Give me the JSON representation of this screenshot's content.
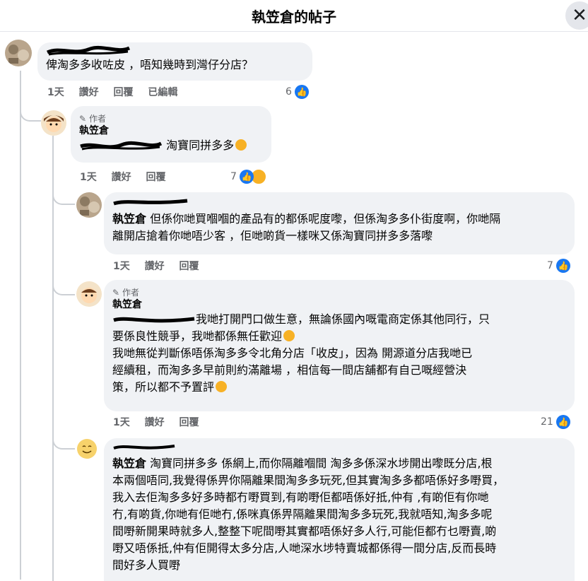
{
  "header": {
    "title": "執笠倉的帖子",
    "close_label": "✕"
  },
  "author_tag_label": "作者",
  "obj_char": "OBJ",
  "comments": [
    {
      "text": "俾淘多多收咗皮 ，唔知幾時到灣仔分店？",
      "time": "1天",
      "like": "讚好",
      "reply": "回覆",
      "edited": "已編輯",
      "reactions": "6"
    },
    {
      "name": "執笠倉",
      "text": "淘寶同拼多多",
      "time": "1天",
      "like": "讚好",
      "reply": "回覆",
      "reactions": "7"
    },
    {
      "mention": "執笠倉",
      "text_line1": "但係你哋買嗰嗰的產品有的都係呢度嚟，但係淘多多仆街度啊，你哋隔",
      "text_line2": "離開店搶着你哋唔少客 ，佢哋啲貨一樣咪又係淘寶同拼多多落嚟",
      "time": "1天",
      "like": "讚好",
      "reply": "回覆",
      "reactions": "7"
    },
    {
      "name": "執笠倉",
      "text_line1": "我哋打開門口做生意，無論係國內嘅電商定係其他同行，只",
      "text_line2": "要係良性競爭，我哋都係無任歡迎",
      "text_line3": "我哋無從判斷係唔係淘多多令北角分店「收皮」，因為 開源道分店我哋已",
      "text_line4": "經續租，而淘多多早前則約滿離場 ，相信每一間店舖都有自己嘅經營決",
      "text_line5": "策，所以都不予置評",
      "time": "1天",
      "like": "讚好",
      "reply": "回覆",
      "reactions": "21"
    },
    {
      "mention": "執笠倉",
      "text_line1": "淘寶同拼多多 係網上,而你隔離嗰間 淘多多係深水埗開出嚟既分店,根",
      "text_line2": "本兩個唔同,我覺得係畀你隔離果間淘多多玩死,但其實淘多多都唔係好多嘢買，",
      "text_line3": "我入去佢淘多多好多時都冇嘢買到,有啲嘢佢都唔係好抵,仲有 ,有啲佢有你哋",
      "text_line4": "冇,有啲貨,你哋有佢哋冇,係咪真係畀隔離果間淘多多玩死,我就唔知,淘多多呢",
      "text_line5": "間嘢新開果時就多人,整整下呢間嘢其實都唔係好多人行,可能佢都冇乜嘢賣,啲",
      "text_line6": "嘢又唔係抵,仲有佢開得太多分店,人哋深水埗特賣城都係得一間分店,反而長時",
      "text_line7": "間好多人買嘢"
    }
  ],
  "colors": {
    "like_blue": "#1877f2",
    "bubble_gray": "#f0f2f5",
    "meta_gray": "#65676b"
  }
}
